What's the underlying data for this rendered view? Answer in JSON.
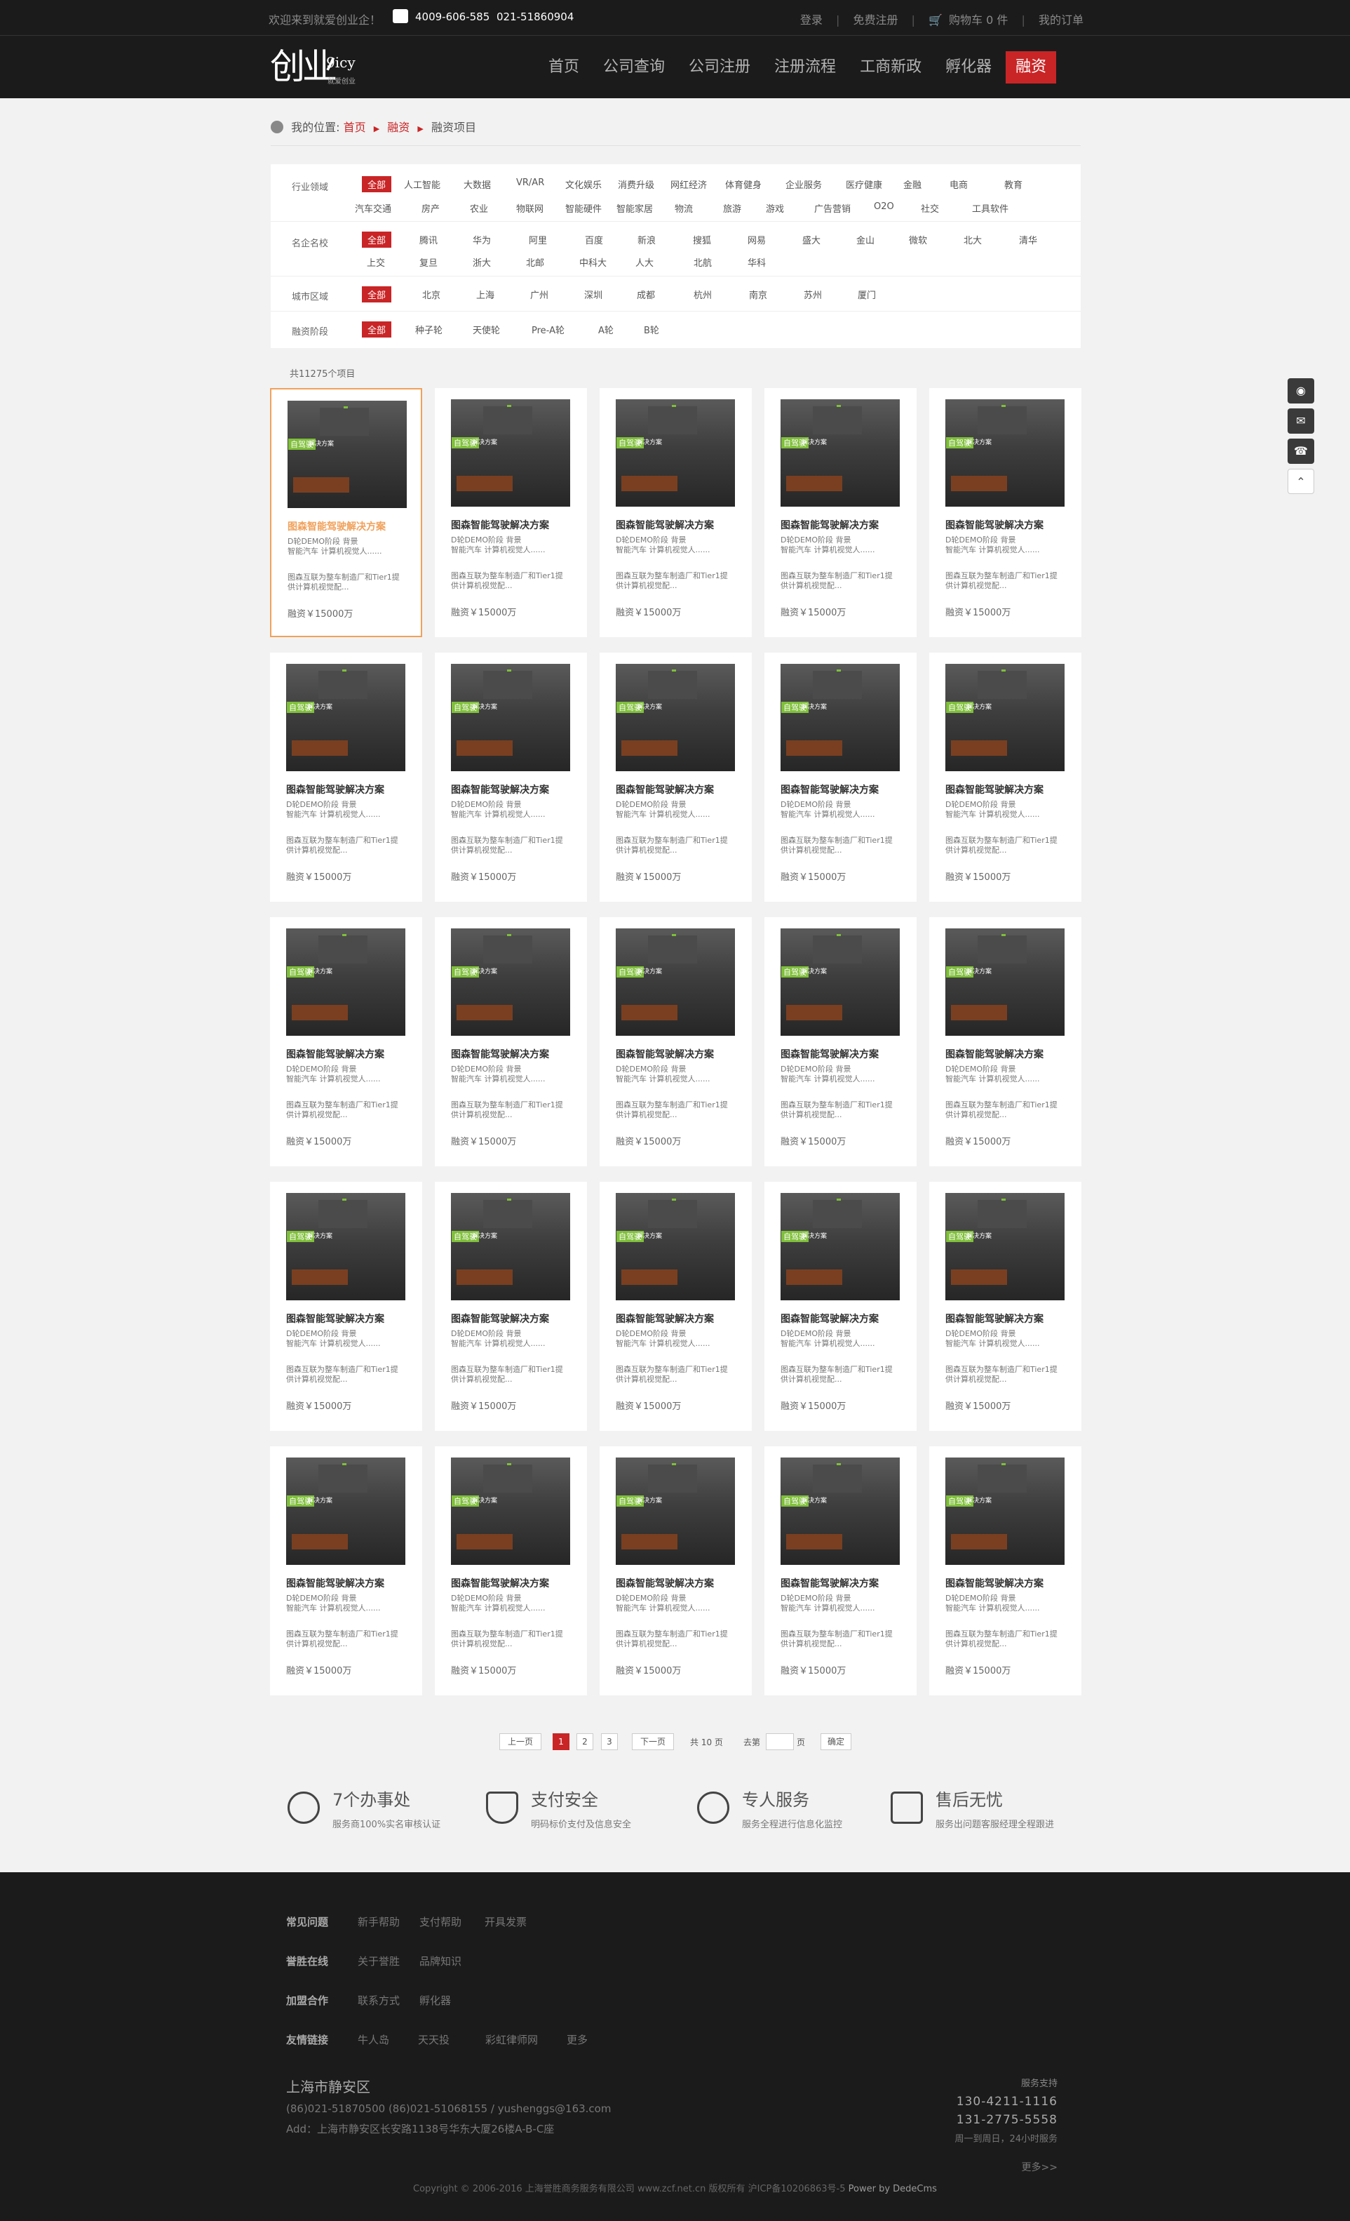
{
  "topbar": {
    "welcome": "欢迎来到就爱创业企！",
    "phone1": "4009-606-585",
    "phone2": "021-51860904",
    "login": "登录",
    "register": "免费注册",
    "cart": "购物车 0 件",
    "orders": "我的订单"
  },
  "header": {
    "logo_mark": "创业",
    "logo_en": "9icy",
    "logo_sub": "就爱创业",
    "nav": [
      "首页",
      "公司查询",
      "公司注册",
      "注册流程",
      "工商新政",
      "孵化器",
      "融资"
    ]
  },
  "breadcrumb": {
    "label": "我的位置:",
    "home": "首页",
    "section": "融资",
    "current": "融资项目"
  },
  "filters": {
    "industry": {
      "label": "行业领域",
      "row1": [
        "全部",
        "人工智能",
        "大数据",
        "VR/AR",
        "文化娱乐",
        "消费升级",
        "网红经济",
        "体育健身",
        "企业服务",
        "医疗健康",
        "金融",
        "电商",
        "教育"
      ],
      "row2": [
        "汽车交通",
        "房产",
        "农业",
        "物联网",
        "智能硬件",
        "智能家居",
        "物流",
        "旅游",
        "游戏",
        "广告营销",
        "O2O",
        "社交",
        "工具软件"
      ]
    },
    "company": {
      "label": "名企名校",
      "row1": [
        "全部",
        "腾讯",
        "华为",
        "阿里",
        "百度",
        "新浪",
        "搜狐",
        "网易",
        "盛大",
        "金山",
        "微软",
        "北大",
        "清华"
      ],
      "row2": [
        "上交",
        "复旦",
        "浙大",
        "北邮",
        "中科大",
        "人大",
        "北航",
        "华科"
      ]
    },
    "city": {
      "label": "城市区域",
      "row1": [
        "全部",
        "北京",
        "上海",
        "广州",
        "深圳",
        "成都",
        "杭州",
        "南京",
        "苏州",
        "厦门"
      ]
    },
    "stage": {
      "label": "融资阶段",
      "row1": [
        "全部",
        "种子轮",
        "天使轮",
        "Pre-A轮",
        "A轮",
        "B轮"
      ]
    }
  },
  "count": "共11275个项目",
  "project": {
    "image_tag": "自驾驶",
    "image_tag2": "解决方案",
    "title": "图森智能驾驶解决方案",
    "d1": "D轮DEMO阶段 背景",
    "d2": "智能汽车 计算机视觉人......",
    "d3": "图森互联为整车制造厂和Tier1提",
    "d4": "供计算机视觉配...",
    "fund": "融资￥15000万"
  },
  "pager": {
    "prev": "上一页",
    "pages": [
      "1",
      "2",
      "3"
    ],
    "next": "下一页",
    "total": "共 10 页",
    "goto": "去第",
    "page_unit": "页",
    "confirm": "确定"
  },
  "services": [
    {
      "title": "7个办事处",
      "desc": "服务商100%实名审核认证",
      "icon": "award-icon"
    },
    {
      "title": "支付安全",
      "desc": "明码标价支付及信息安全",
      "icon": "shield-check-icon"
    },
    {
      "title": "专人服务",
      "desc": "服务全程进行信息化监控",
      "icon": "user-icon"
    },
    {
      "title": "售后无忧",
      "desc": "服务出问题客服经理全程跟进",
      "icon": "thumbs-up-icon"
    }
  ],
  "footer": {
    "rows": [
      {
        "head": "常见问题",
        "links": [
          "新手帮助",
          "支付帮助",
          "开具发票"
        ]
      },
      {
        "head": "誉胜在线",
        "links": [
          "关于誉胜",
          "品牌知识"
        ]
      },
      {
        "head": "加盟合作",
        "links": [
          "联系方式",
          "孵化器"
        ]
      },
      {
        "head": "友情链接",
        "links": [
          "牛人岛",
          "天天投",
          "彩虹律师网",
          "更多"
        ]
      }
    ],
    "city": "上海市静安区",
    "tel": "(86)021-51870500      (86)021-51068155 / yushenggs@163.com",
    "addr": "Add：上海市静安区长安路1138号华东大厦26楼A-B-C座",
    "support_title": "服务支持",
    "support_tel1": "130-4211-1116",
    "support_tel2": "131-2775-5558",
    "support_hours": "周一到周日，24小时服务",
    "more": "更多>>",
    "copyright": "Copyright © 2006-2016 上海誉胜商务服务有限公司 www.zcf.net.cn 版权所有  沪ICP备10206863号-5",
    "power": "Power by DedeCms"
  },
  "side": [
    "qq-icon",
    "wechat-icon",
    "phone-icon",
    "back-to-top-icon"
  ],
  "colors": {
    "accent": "#c92526",
    "highlight": "#f0a15b",
    "dark": "#1b1b1b"
  }
}
